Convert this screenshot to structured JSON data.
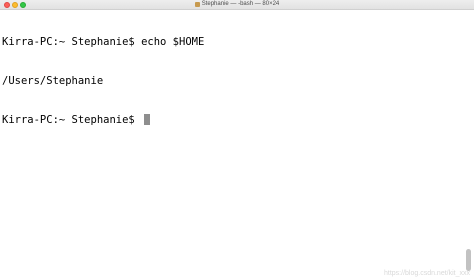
{
  "window": {
    "title": "Stephanie — -bash — 80×24",
    "title_icon": "home-folder-icon"
  },
  "terminal": {
    "lines": [
      "Kirra-PC:~ Stephanie$ echo $HOME",
      "/Users/Stephanie"
    ],
    "prompt": "Kirra-PC:~ Stephanie$ ",
    "cursor_color": "#8e8e8e"
  },
  "watermark": "https://blog.csdn.net/kit_xxx"
}
